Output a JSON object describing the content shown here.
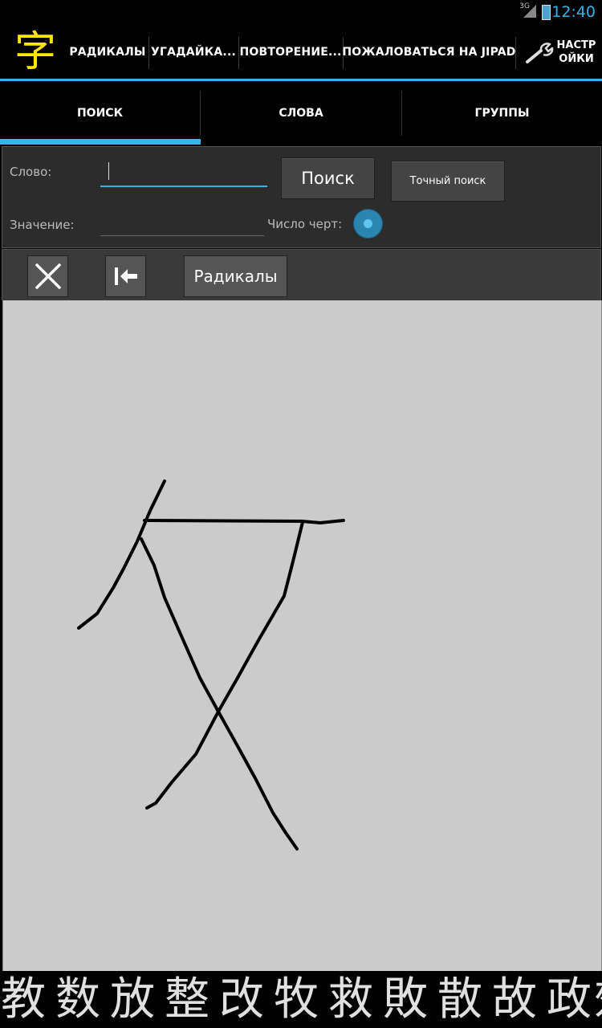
{
  "status": {
    "network": "3G",
    "time": "12:40"
  },
  "app": {
    "logo_char": "字"
  },
  "menu": [
    {
      "label": "РАДИКАЛЫ"
    },
    {
      "label": "УГАДАЙКА..."
    },
    {
      "label": "ПОВТОРЕНИЕ..."
    },
    {
      "label": "ПОЖАЛОВАТЬСЯ НА JIPAD"
    }
  ],
  "settings": {
    "label_line1": "НАСТР",
    "label_line2": "ОЙКИ"
  },
  "tabs": [
    {
      "label": "ПОИСК",
      "selected": true
    },
    {
      "label": "СЛОВА",
      "selected": false
    },
    {
      "label": "ГРУППЫ",
      "selected": false
    }
  ],
  "search": {
    "word_label": "Слово:",
    "word_value": "",
    "meaning_label": "Значение:",
    "meaning_value": "",
    "stroke_count_label": "Число черт:",
    "search_button": "Поиск",
    "exact_search_button": "Точный поиск"
  },
  "drawing": {
    "clear_icon": "close-icon",
    "backspace_icon": "backspace-icon",
    "radicals_button": "Радикалы"
  },
  "results": [
    "教",
    "数",
    "放",
    "整",
    "改",
    "牧",
    "救",
    "敗",
    "散",
    "故",
    "政",
    "效"
  ]
}
